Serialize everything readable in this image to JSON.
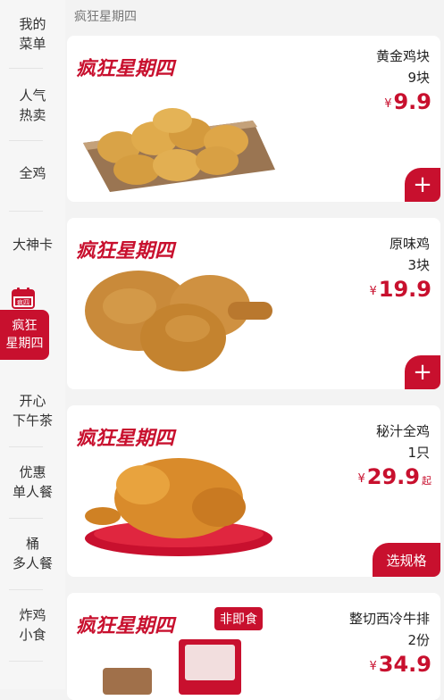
{
  "sidebar": {
    "items": [
      {
        "label": "我的\n菜单"
      },
      {
        "label": "人气\n热卖"
      },
      {
        "label": "全鸡"
      },
      {
        "label": "大神卡"
      },
      {
        "label": "疯狂\n星期四",
        "badge": "疯四"
      },
      {
        "label": "开心\n下午茶"
      },
      {
        "label": "优惠\n单人餐"
      },
      {
        "label": "桶\n多人餐"
      },
      {
        "label": "炸鸡\n小食"
      }
    ]
  },
  "section_title": "疯狂星期四",
  "badge_text": "疯狂星期四",
  "products": [
    {
      "name": "黄金鸡块",
      "qty": "9块",
      "currency": "¥",
      "price": "9.9",
      "action": "+"
    },
    {
      "name": "原味鸡",
      "qty": "3块",
      "currency": "¥",
      "price": "19.9",
      "action": "+"
    },
    {
      "name": "秘汁全鸡",
      "qty": "1只",
      "currency": "¥",
      "price": "29.9",
      "suffix": "起",
      "action": "选规格"
    },
    {
      "name": "整切西冷牛排",
      "qty": "2份",
      "currency": "¥",
      "price": "34.9",
      "tag": "非即食"
    }
  ],
  "colors": {
    "accent": "#c8102e",
    "background": "#f3f3f3"
  }
}
